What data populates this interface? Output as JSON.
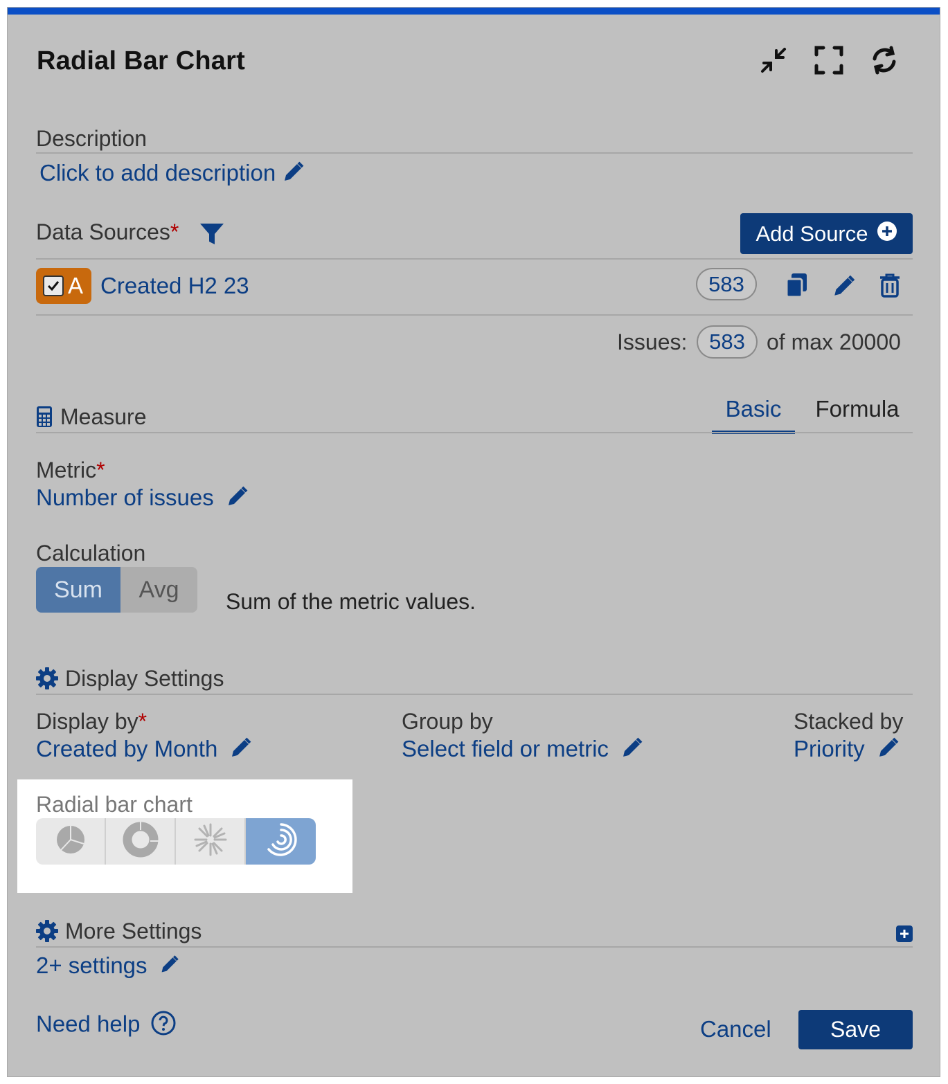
{
  "dialog": {
    "title": "Radial Bar Chart"
  },
  "description": {
    "label": "Description",
    "placeholder_link": "Click to add description"
  },
  "data_sources": {
    "label": "Data Sources",
    "required_mark": "*",
    "add_button": "Add Source",
    "items": [
      {
        "letter": "A",
        "name": "Created H2 23",
        "count": "583",
        "checked": true,
        "color": "#c8690d"
      }
    ],
    "issues_label": "Issues:",
    "issues_count": "583",
    "issues_max": "of max 20000"
  },
  "measure": {
    "label": "Measure",
    "tabs": [
      {
        "label": "Basic",
        "active": true
      },
      {
        "label": "Formula",
        "active": false
      }
    ],
    "metric_label": "Metric",
    "metric_value": "Number of issues",
    "calculation_label": "Calculation",
    "calc_options": [
      "Sum",
      "Avg"
    ],
    "calc_selected": "Sum",
    "calc_description": "Sum of the metric values."
  },
  "display_settings": {
    "label": "Display Settings",
    "display_by_label": "Display by",
    "display_by_value": "Created by Month",
    "group_by_label": "Group by",
    "group_by_value": "Select field or metric",
    "stacked_by_label": "Stacked by",
    "stacked_by_value": "Priority",
    "chart_type_label": "Radial bar chart",
    "chart_types": [
      "pie-icon",
      "donut-icon",
      "starburst-icon",
      "radial-bar-icon"
    ],
    "chart_type_selected": "radial-bar-icon"
  },
  "more_settings": {
    "label": "More Settings",
    "link": "2+ settings"
  },
  "footer": {
    "help": "Need help",
    "cancel": "Cancel",
    "save": "Save"
  },
  "colors": {
    "accent": "#0d3a78",
    "link": "#0c3e84",
    "topbar": "#0b4fc6",
    "source_badge": "#c8690d",
    "selected_segment": "#4f76a6"
  }
}
